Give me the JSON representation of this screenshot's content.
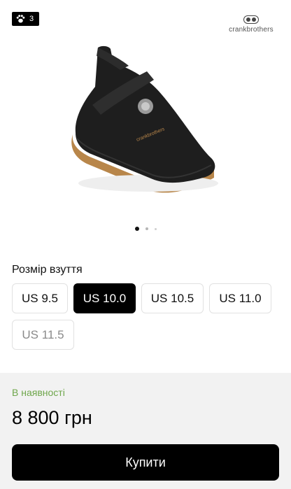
{
  "header": {
    "badge_count": "3",
    "badge_icon": "paw-icon",
    "brand_name": "crankbrothers"
  },
  "gallery": {
    "slide_count": 3,
    "active_slide": 1,
    "product_image_alt": "shoe"
  },
  "size_selector": {
    "title": "Розмір взуття",
    "options": [
      {
        "label": "US 9.5",
        "state": "available"
      },
      {
        "label": "US 10.0",
        "state": "selected"
      },
      {
        "label": "US 10.5",
        "state": "available"
      },
      {
        "label": "US 11.0",
        "state": "available"
      },
      {
        "label": "US 11.5",
        "state": "unavailable"
      }
    ]
  },
  "purchase": {
    "stock_status": "В наявності",
    "price": "8 800 грн",
    "buy_label": "Купити"
  },
  "colors": {
    "accent_green": "#6ea64b",
    "button_black": "#000000",
    "panel_gray": "#f2f2f2"
  }
}
